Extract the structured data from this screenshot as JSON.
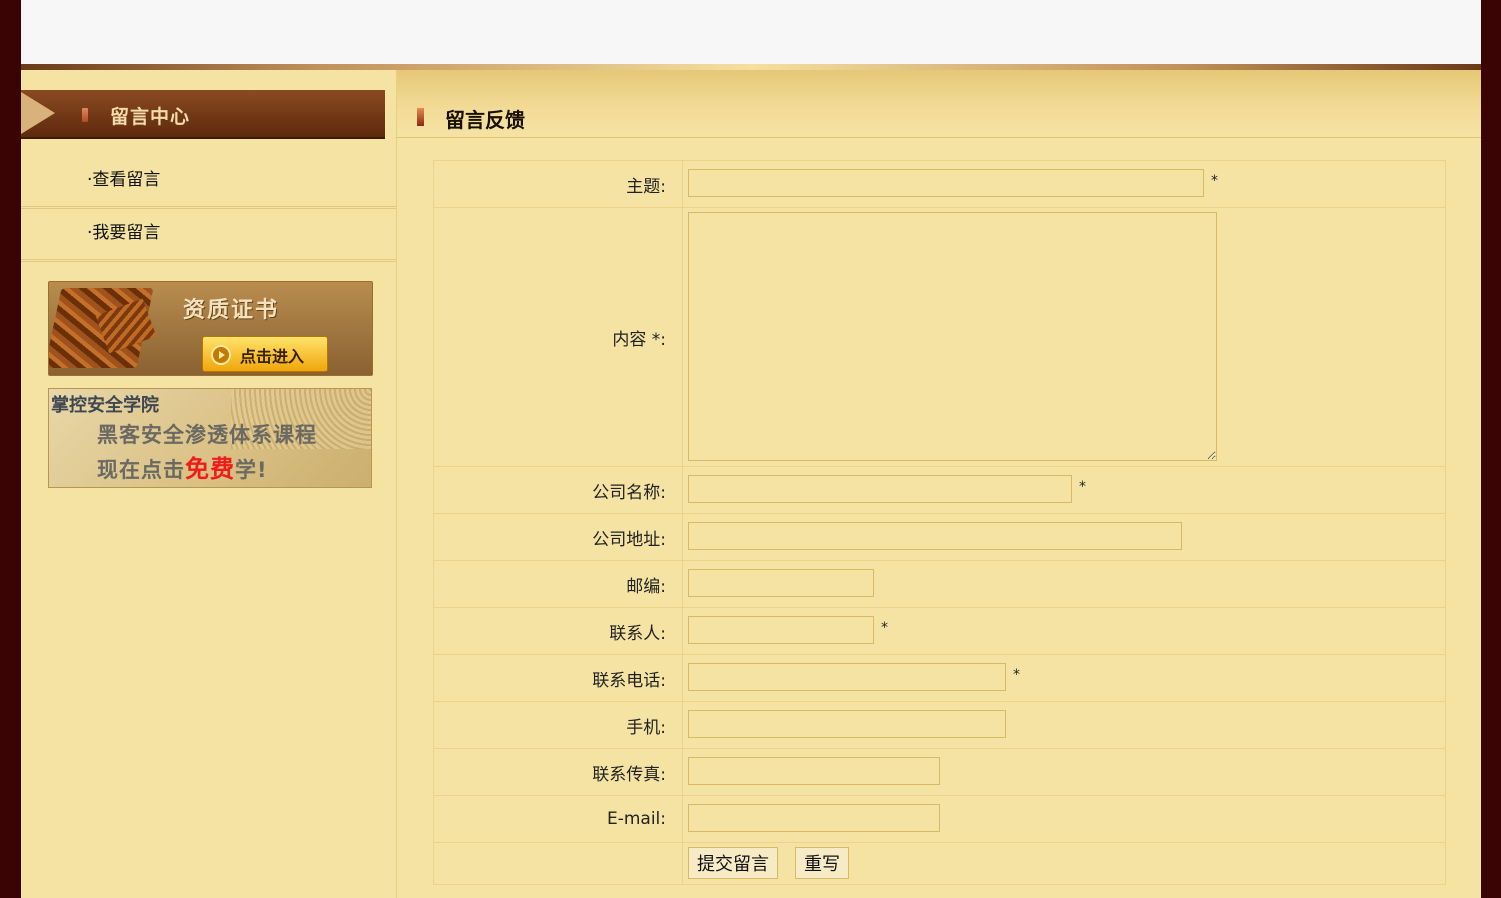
{
  "sidebar": {
    "title": "留言中心",
    "links": [
      "·查看留言",
      "·我要留言"
    ],
    "cert_banner": {
      "title": "资质证书",
      "button": "点击进入"
    },
    "school_banner": {
      "title": "掌控安全学院",
      "line1": "黑客安全渗透体系课程",
      "line2_pre": "现在点击",
      "line2_highlight": "免费",
      "line2_post": "学!"
    }
  },
  "main": {
    "title": "留言反馈",
    "fields": {
      "subject": {
        "label": "主题:",
        "required": "*"
      },
      "content": {
        "label": "内容 *:"
      },
      "company": {
        "label": "公司名称:",
        "required": "*"
      },
      "address": {
        "label": "公司地址:"
      },
      "zipcode": {
        "label": "邮编:"
      },
      "contact": {
        "label": "联系人:",
        "required": "*"
      },
      "phone": {
        "label": "联系电话:",
        "required": "*"
      },
      "mobile": {
        "label": "手机:"
      },
      "fax": {
        "label": "联系传真:"
      },
      "email": {
        "label": "E-mail:"
      }
    },
    "submit_label": "提交留言",
    "reset_label": "重写"
  },
  "colors": {
    "background": "#f5e3a4",
    "frame": "#3a0404",
    "accent": "#5e2a0c"
  }
}
